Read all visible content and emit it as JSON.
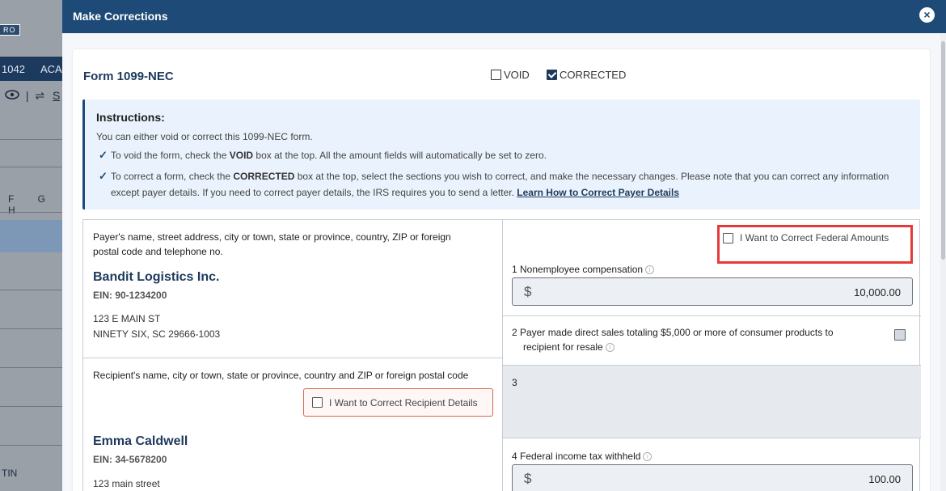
{
  "background": {
    "badge": "RO",
    "navbar": [
      "1042",
      "ACA"
    ],
    "tool_link": "S",
    "letters": "F G H",
    "tin_label": "TIN"
  },
  "modal": {
    "title": "Make Corrections",
    "close_icon": "×"
  },
  "form": {
    "title": "Form 1099-NEC",
    "void_label": "VOID",
    "void_checked": false,
    "corrected_label": "CORRECTED",
    "corrected_checked": true
  },
  "instructions": {
    "title": "Instructions:",
    "intro": "You can either void or correct this 1099-NEC form.",
    "item1_pre": "To void the form, check the ",
    "item1_bold": "VOID",
    "item1_post": " box at the top. All the amount fields will automatically be set to zero.",
    "item2_pre": "To correct a form, check the ",
    "item2_bold": "CORRECTED",
    "item2_post": " box at the top, select the sections you wish to correct, and make the necessary changes. Please note that you can correct any information except payer details. If you need to correct payer details, the IRS requires you to send a letter. ",
    "item2_link": "Learn How to Correct Payer Details"
  },
  "payer": {
    "label_line1": "Payer's name, street address, city or town, state or province, country, ZIP or foreign",
    "label_line2": "postal code and telephone no.",
    "name": "Bandit Logistics Inc.",
    "ein": "EIN: 90-1234200",
    "address1": "123 E MAIN ST",
    "address2": "NINETY SIX, SC 29666-1003"
  },
  "recipient": {
    "label": "Recipient's name, city or town, state or province, country and ZIP or foreign postal code",
    "correct_button": "I Want to Correct Recipient Details",
    "name": "Emma Caldwell",
    "ein": "EIN: 34-5678200",
    "address1": "123 main street"
  },
  "federal": {
    "correct_button": "I Want to Correct Federal Amounts",
    "box1_label": "1  Nonemployee compensation",
    "box1_currency": "$",
    "box1_value": "10,000.00",
    "box2_label_line1": "2  Payer made direct sales totaling $5,000 or more of consumer products to",
    "box2_label_line2": "recipient for resale",
    "box2_checked": false,
    "box3_label": "3",
    "box4_label": "4  Federal income tax withheld",
    "box4_currency": "$",
    "box4_value": "100.00"
  }
}
